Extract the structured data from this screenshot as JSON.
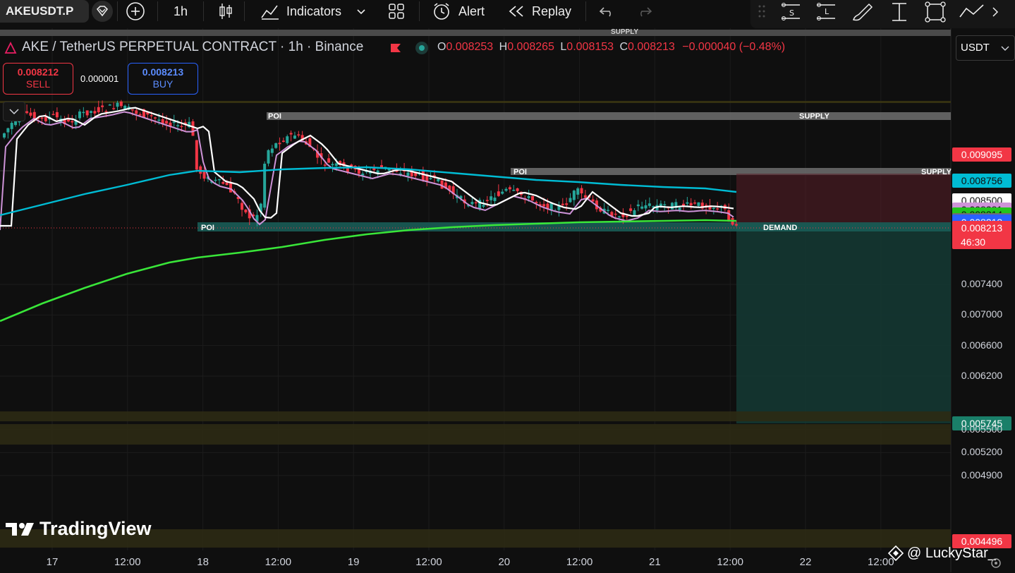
{
  "toolbar": {
    "symbol": "AKEUSDT.P",
    "interval": "1h",
    "indicators_label": "Indicators",
    "alert_label": "Alert",
    "replay_label": "Replay"
  },
  "legend": {
    "title": "AKE / TetherUS PERPETUAL CONTRACT · 1h · Binance",
    "open_key": "O",
    "open": "0.008253",
    "high_key": "H",
    "high": "0.008265",
    "low_key": "L",
    "low": "0.008153",
    "close_key": "C",
    "close": "0.008213",
    "change": "−0.000040 (−0.48%)"
  },
  "trade": {
    "sell_price": "0.008212",
    "sell_label": "SELL",
    "spread": "0.000001",
    "buy_price": "0.008213",
    "buy_label": "BUY"
  },
  "currency": "USDT",
  "watermark": "TradingView",
  "credit": "@ LuckyStar_",
  "colors": {
    "up": "#26a69a",
    "down": "#f23645",
    "ema_fast": "#ce93d8",
    "ema_mid": "#ffffff",
    "ema_slow": "#00bcd4",
    "ema_long": "#39e639",
    "demand": "#1a5c56",
    "supply": "#6e6e6e"
  },
  "zones": {
    "poi_1": "POI",
    "poi_2": "POI",
    "poi_3": "POI",
    "supply_1": "SUPPLY",
    "supply_2": "SUPPLY",
    "supply_top": "SUPPLY",
    "demand": "DEMAND"
  },
  "price_labels": [
    {
      "value": "0.009095",
      "bg": "#f23645",
      "fg": "#ffffff"
    },
    {
      "value": "0.008756",
      "bg": "#00bcd4",
      "fg": "#0f0f0f"
    },
    {
      "value": "0.008500",
      "bg": "#ffffff",
      "fg": "#0f0f0f"
    },
    {
      "value": "0.008381",
      "bg": "#ce93d8",
      "fg": "#0f0f0f"
    },
    {
      "value": "0.008314",
      "bg": "#22c51d",
      "fg": "#0f0f0f"
    },
    {
      "value": "0.008243",
      "bg": "#6e6e6e",
      "fg": "#ffffff"
    },
    {
      "value": "0.008221",
      "bg": "#2962ff",
      "fg": "#ffffff"
    },
    {
      "value": "0.008213",
      "bg": "#2962ff",
      "fg": "#ffffff"
    }
  ],
  "last_price": {
    "value": "0.008213",
    "countdown": "46:30"
  },
  "target_label": "0.005745",
  "bottom_label": "0.004496",
  "price_scale": [
    "0.007400",
    "0.007000",
    "0.006600",
    "0.006200",
    "0.005500",
    "0.005200",
    "0.004900"
  ],
  "time_scale": [
    "17",
    "12:00",
    "18",
    "12:00",
    "19",
    "12:00",
    "20",
    "12:00",
    "21",
    "12:00",
    "22",
    "12:00"
  ],
  "chart_data": {
    "type": "candlestick",
    "title": "AKE / TetherUS PERPETUAL CONTRACT · 1h · Binance",
    "interval": "1h",
    "x_range": [
      "17",
      "22 12:00"
    ],
    "ylim": [
      0.0044,
      0.0093
    ],
    "last": {
      "open": 0.008253,
      "high": 0.008265,
      "low": 0.008153,
      "close": 0.008213
    },
    "moving_averages": [
      {
        "color": "#ce93d8",
        "last_value": 0.008381
      },
      {
        "color": "#ffffff",
        "last_value": 0.0085
      },
      {
        "color": "#00bcd4",
        "last_value": 0.008756
      },
      {
        "color": "#39e639",
        "last_value": 0.008314
      }
    ],
    "zones": [
      {
        "label": "SUPPLY",
        "price": 0.009095
      },
      {
        "label": "SUPPLY",
        "price": 0.008243
      },
      {
        "label": "DEMAND",
        "price": 0.008213
      }
    ],
    "target": 0.005745,
    "grid": true
  }
}
